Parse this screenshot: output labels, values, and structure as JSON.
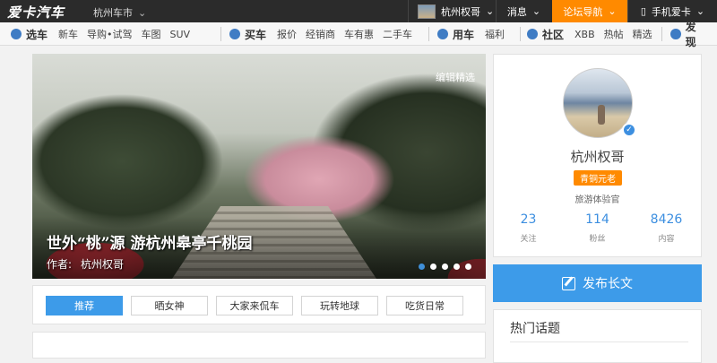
{
  "topbar": {
    "logo": "爱卡汽车",
    "city": "杭州车市",
    "username": "杭州权哥",
    "messages": "消息",
    "forum_nav": "论坛导航",
    "mobile": "手机爱卡",
    "forum_bg": "#ff8a00"
  },
  "nav": {
    "groups": [
      {
        "title": "选车",
        "icon": "car-icon",
        "items": [
          "新车",
          "导购•试驾",
          "车图",
          "SUV"
        ]
      },
      {
        "title": "买车",
        "icon": "cart-icon",
        "items": [
          "报价",
          "经销商",
          "车有惠",
          "二手车"
        ]
      },
      {
        "title": "用车",
        "icon": "wrench-icon",
        "items": [
          "福利"
        ]
      },
      {
        "title": "社区",
        "icon": "community-icon",
        "items": [
          "XBB",
          "热帖",
          "精选"
        ]
      },
      {
        "title": "发现",
        "icon": "compass-icon",
        "items": []
      }
    ]
  },
  "hero": {
    "tag": "编辑精选",
    "title": "世外“桃”源  游杭州皋亭千桃园",
    "author_label": "作者:",
    "author": "杭州权哥",
    "slide_count": 5,
    "active_slide": 1
  },
  "tabs": [
    "推荐",
    "晒女神",
    "大家来侃车",
    "玩转地球",
    "吃货日常"
  ],
  "active_tab": 0,
  "profile": {
    "name": "杭州权哥",
    "badge": "青铜元老",
    "role": "旅游体验官",
    "stats": [
      {
        "num": "23",
        "label": "关注"
      },
      {
        "num": "114",
        "label": "粉丝"
      },
      {
        "num": "8426",
        "label": "内容"
      }
    ]
  },
  "post_button": "发布长文",
  "hot_topics": {
    "title": "热门话题"
  },
  "colors": {
    "accent": "#3d9be9",
    "orange": "#ff8a00",
    "topbar": "#2b2b2b"
  }
}
